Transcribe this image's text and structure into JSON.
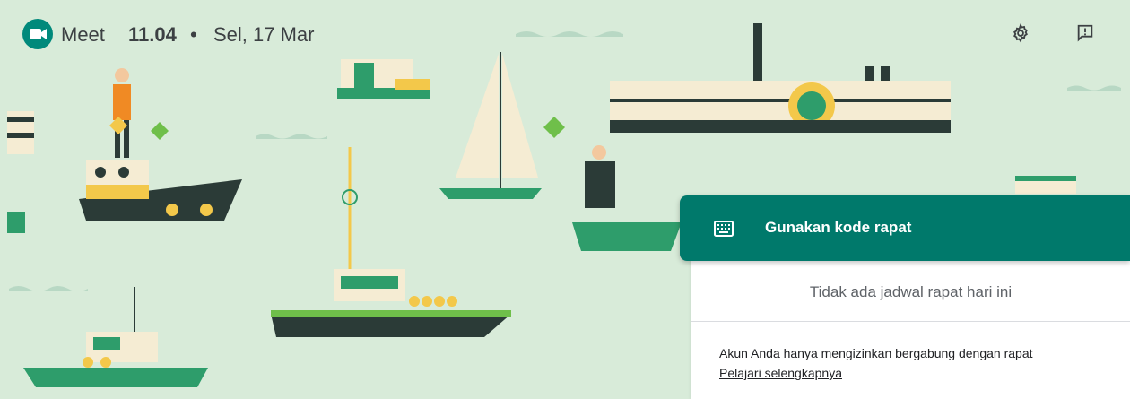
{
  "header": {
    "app_name": "Meet",
    "time": "11.04",
    "separator": "•",
    "date": "Sel, 17 Mar",
    "settings_icon": "gear-icon",
    "feedback_icon": "feedback-icon"
  },
  "panel": {
    "code_button_label": "Gunakan kode rapat",
    "code_icon": "keyboard-icon",
    "no_meetings_text": "Tidak ada jadwal rapat hari ini",
    "restriction_text": "Akun Anda hanya mengizinkan bergabung dengan rapat",
    "learn_more_link": "Pelajari selengkapnya"
  },
  "colors": {
    "background": "#d8ebd9",
    "accent": "#00796b",
    "text_primary": "#202124",
    "text_secondary": "#5f6368"
  }
}
